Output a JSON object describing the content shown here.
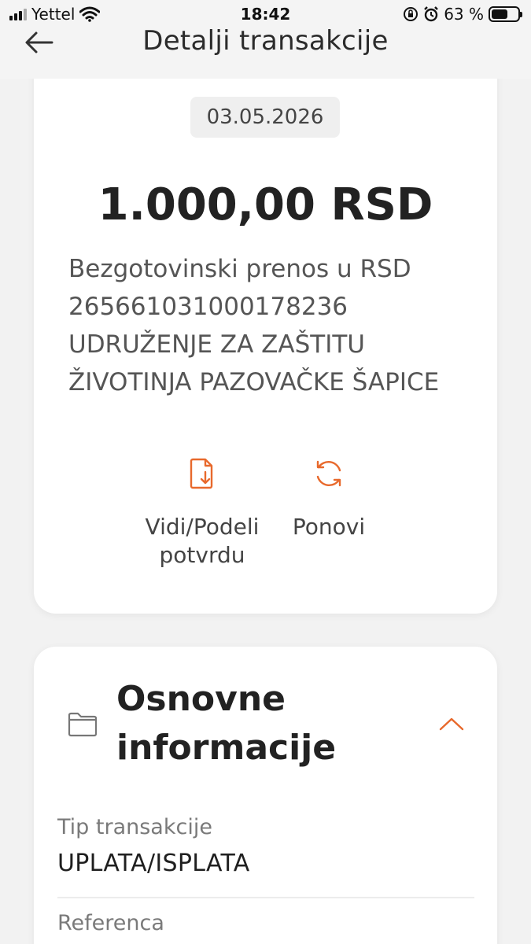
{
  "status_bar": {
    "carrier": "Yettel",
    "time": "18:42",
    "battery": "63 %",
    "battery_level": 0.63
  },
  "header": {
    "title": "Detalji transakcije",
    "back_icon": "arrow-left-icon"
  },
  "transaction": {
    "date": "03.05.2026",
    "amount": "1.000,00 RSD",
    "description_lines": [
      "Bezgotovinski prenos u RSD",
      "265661031000178236",
      "UDRUŽENJE ZA ZAŠTITU",
      "ŽIVOTINJA PAZOVAČKE ŠAPICE"
    ]
  },
  "actions": [
    {
      "label_line1": "Vidi/Podeli",
      "label_line2": "potvrdu",
      "icon": "document-download-icon"
    },
    {
      "label_line1": "Ponovi",
      "icon": "refresh-icon"
    }
  ],
  "section": {
    "title_line1": "Osnovne",
    "title_line2": "informacije",
    "icon": "folder-icon",
    "toggle_icon": "chevron-up-icon",
    "fields": [
      {
        "label": "Tip transakcije",
        "value": "UPLATA/ISPLATA"
      },
      {
        "label": "Referenca",
        "value": ""
      }
    ]
  },
  "colors": {
    "accent": "#e8692c",
    "background": "#f2f2f2",
    "card": "#ffffff"
  }
}
